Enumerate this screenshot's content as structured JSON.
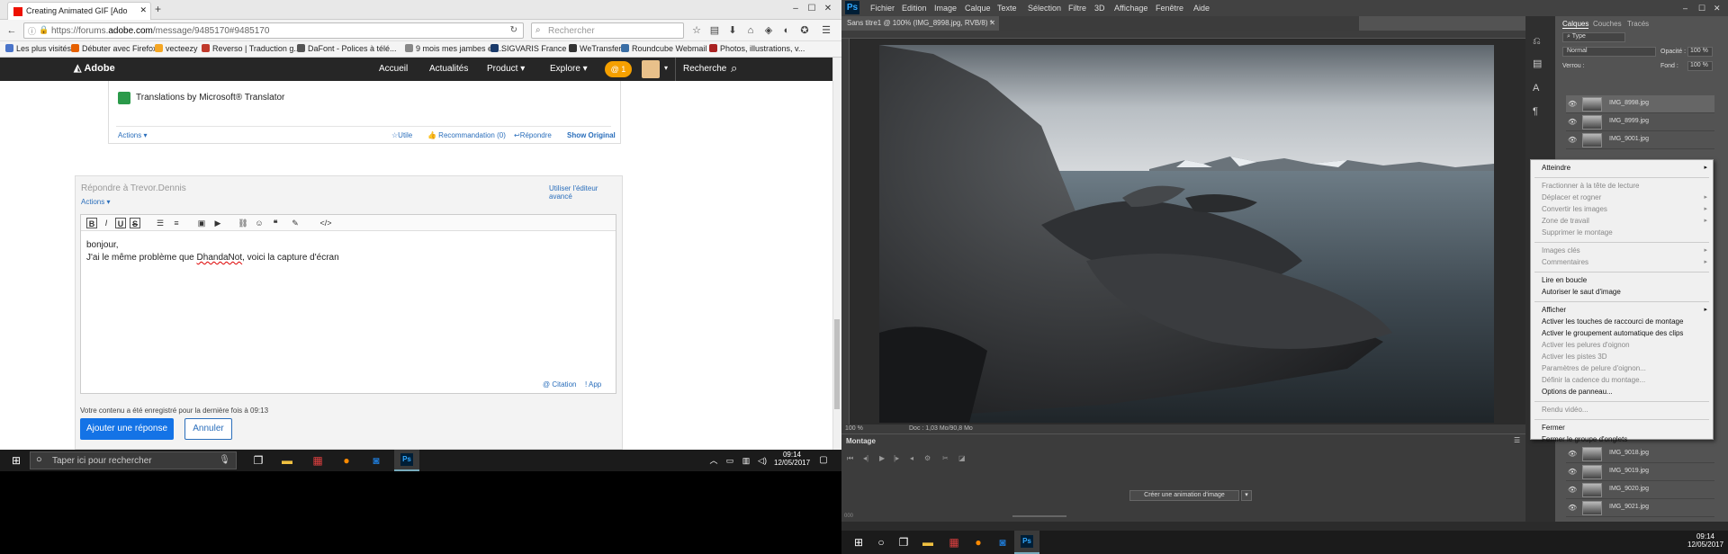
{
  "firefox": {
    "tab_title": "Creating Animated GIF [Ado",
    "url_prefix": "https://forums.",
    "url_domain": "adobe.com",
    "url_suffix": "/message/9485170#9485170",
    "search_placeholder": "Rechercher",
    "bookmarks": [
      {
        "label": "Les plus visités",
        "color": "#4a74c9"
      },
      {
        "label": "Débuter avec Firefox",
        "color": "#e66000"
      },
      {
        "label": "vecteezy",
        "color": "#f5a623"
      },
      {
        "label": "Reverso | Traduction g...",
        "color": "#c0392b"
      },
      {
        "label": "DaFont - Polices à télé...",
        "color": "#555555"
      },
      {
        "label": "9 mois mes jambes et ...",
        "color": "#888888"
      },
      {
        "label": "SIGVARIS France",
        "color": "#1a3a6b"
      },
      {
        "label": "WeTransfer",
        "color": "#333333"
      },
      {
        "label": "Roundcube Webmail ...",
        "color": "#3a6ea5"
      },
      {
        "label": "Photos, illustrations, v...",
        "color": "#aa2222"
      }
    ]
  },
  "adobe_nav": {
    "logo": "Adobe",
    "items": [
      "Accueil",
      "Actualités",
      "Product ▾",
      "Explore ▾"
    ],
    "badge": "@ 1",
    "search": "Recherche"
  },
  "post": {
    "translator": "Translations by Microsoft® Translator",
    "actions": "Actions ▾",
    "useful": "☆Utile",
    "recommend": "👍 Recommandation (0)",
    "reply": "↩Répondre",
    "show_original": "Show Original"
  },
  "reply_box": {
    "title": "Répondre à Trevor.Dennis",
    "advanced": "Utiliser l'éditeur avancé",
    "actions": "Actions ▾",
    "line1": "bonjour,",
    "line2_pre": "J'ai le même problème que ",
    "line2_name": "DhandaNot",
    "line2_post": ", voici la capture d'écran",
    "citation": "@ Citation",
    "app": "! App",
    "saved": "Votre contenu a été enregistré pour la dernière fois à 09:13",
    "submit": "Ajouter une réponse",
    "cancel": "Annuler"
  },
  "taskbar_left": {
    "search": "Taper ici pour rechercher",
    "time": "09:14",
    "date": "12/05/2017"
  },
  "photoshop": {
    "menu": [
      "Fichier",
      "Edition",
      "Image",
      "Calque",
      "Texte",
      "Sélection",
      "Filtre",
      "3D",
      "Affichage",
      "Fenêtre",
      "Aide"
    ],
    "doc_tab": "Sans titre1 @ 100% (IMG_8998.jpg, RVB/8) *",
    "zoom": "100 %",
    "doc_info": "Doc : 1,03 Mo/90,8 Mo",
    "timeline_title": "Montage",
    "create_anim": "Créer une animation d'image",
    "timeline_zoom": "000",
    "panel_tabs": [
      "Calques",
      "Couches",
      "Tracés"
    ],
    "filter_type": "Type",
    "blend_mode": "Normal",
    "opacity_label": "Opacité :",
    "opacity": "100 %",
    "lock_label": "Verrou :",
    "fill_label": "Fond :",
    "fill": "100 %",
    "layers_top": [
      "IMG_8998.jpg",
      "IMG_8999.jpg",
      "IMG_9001.jpg"
    ],
    "layers_bottom": [
      "IMG_9018.jpg",
      "IMG_9019.jpg",
      "IMG_9020.jpg",
      "IMG_9021.jpg"
    ],
    "context_menu": [
      {
        "label": "Atteindre",
        "disabled": false,
        "sub": true
      },
      {
        "sep": true
      },
      {
        "label": "Fractionner à la tête de lecture",
        "disabled": true
      },
      {
        "label": "Déplacer et rogner",
        "disabled": true,
        "sub": true
      },
      {
        "label": "Convertir les images",
        "disabled": true,
        "sub": true
      },
      {
        "label": "Zone de travail",
        "disabled": true,
        "sub": true
      },
      {
        "label": "Supprimer le montage",
        "disabled": true
      },
      {
        "sep": true
      },
      {
        "label": "Images clés",
        "disabled": true,
        "sub": true
      },
      {
        "label": "Commentaires",
        "disabled": true,
        "sub": true
      },
      {
        "sep": true
      },
      {
        "label": "Lire en boucle",
        "disabled": false
      },
      {
        "label": "Autoriser le saut d'image",
        "disabled": false
      },
      {
        "sep": true
      },
      {
        "label": "Afficher",
        "disabled": false,
        "sub": true
      },
      {
        "label": "Activer les touches de raccourci de montage",
        "disabled": false
      },
      {
        "label": "Activer le groupement automatique des clips",
        "disabled": false
      },
      {
        "label": "Activer les pelures d'oignon",
        "disabled": true
      },
      {
        "label": "Activer les pistes 3D",
        "disabled": true
      },
      {
        "label": "Paramètres de pelure d'oignon...",
        "disabled": true
      },
      {
        "label": "Définir la cadence du montage...",
        "disabled": true
      },
      {
        "label": "Options de panneau...",
        "disabled": false
      },
      {
        "sep": true
      },
      {
        "label": "Rendu vidéo...",
        "disabled": true
      },
      {
        "sep": true
      },
      {
        "label": "Fermer",
        "disabled": false
      },
      {
        "label": "Fermer le groupe d'onglets",
        "disabled": false
      }
    ]
  },
  "taskbar_right": {
    "time": "09:14",
    "date": "12/05/2017"
  }
}
